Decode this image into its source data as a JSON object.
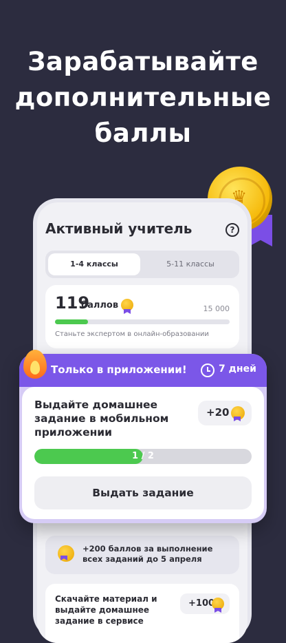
{
  "headline": {
    "line1": "Зарабатывайте",
    "line2": "дополнительные",
    "line3": "баллы"
  },
  "screen": {
    "title": "Активный учитель",
    "help_icon": "?",
    "tabs": [
      {
        "label": "1-4 классы",
        "selected": true
      },
      {
        "label": "5-11 классы",
        "selected": false
      }
    ],
    "points": {
      "value": "119",
      "label": "баллов",
      "max": "15 000",
      "progress": 0.19,
      "subtitle": "Станьте экспертом в онлайн-образовании"
    },
    "bonus": {
      "text": "+200 баллов за выполнение всех заданий до 5 апреля"
    },
    "task2": {
      "text": "Скачайте материал и выдайте домашнее задание в сервисе",
      "reward": "+100"
    }
  },
  "card": {
    "tag": "Только в приложении!",
    "days": "7 дней",
    "task_title": "Выдайте домашнее задание в мобильном приложении",
    "reward": "+20",
    "progress_text": "1 / 2",
    "progress_value": 0.5,
    "button_label": "Выдать задание"
  },
  "colors": {
    "background": "#2c2c3f",
    "accent": "#7b57e8",
    "green": "#4cc94f",
    "gold": "#f4b400"
  }
}
